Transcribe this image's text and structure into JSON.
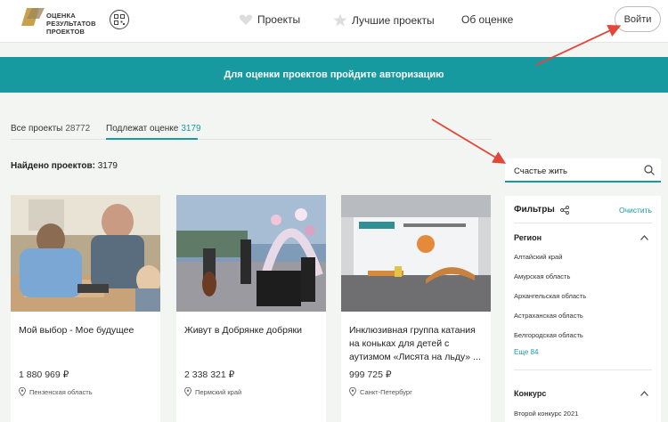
{
  "header": {
    "logo_lines": [
      "ОЦЕНКА",
      "РЕЗУЛЬТАТОВ",
      "ПРОЕКТОВ"
    ],
    "nav": [
      {
        "label": "Проекты",
        "icon": "heart-icon"
      },
      {
        "label": "Лучшие проекты",
        "icon": "star-icon"
      },
      {
        "label": "Об оценке",
        "icon": ""
      }
    ],
    "login_label": "Войти"
  },
  "banner": {
    "text": "Для оценки проектов пройдите авторизацию"
  },
  "tabs": [
    {
      "label": "Все проекты",
      "count": "28772",
      "active": false
    },
    {
      "label": "Подлежат оценке",
      "count": "3179",
      "active": true
    }
  ],
  "found": {
    "label": "Найдено проектов:",
    "count": "3179"
  },
  "search": {
    "value": "Счастье жить"
  },
  "cards": [
    {
      "title": "Мой выбор - Мое будущее",
      "price": "1 880 969 ₽",
      "region": "Пензенская область"
    },
    {
      "title": "Живут в Добрянке добряки",
      "price": "2 338 321 ₽",
      "region": "Пермский край"
    },
    {
      "title": "Инклюзивная группа катания на коньках для детей с аутизмом «Лисята на льду» ...",
      "price": "999 725 ₽",
      "region": "Санкт-Петербург"
    }
  ],
  "filters": {
    "title": "Фильтры",
    "clear_label": "Очистить",
    "region_section": "Регион",
    "regions": [
      "Алтайский край",
      "Амурская область",
      "Архангельская область",
      "Астраханская область",
      "Белгородская область"
    ],
    "more_label": "Еще 84",
    "contest_section": "Конкурс",
    "contest_item": "Второй конкурс 2021"
  },
  "colors": {
    "accent": "#169aa0",
    "annotation": "#e2473b"
  }
}
